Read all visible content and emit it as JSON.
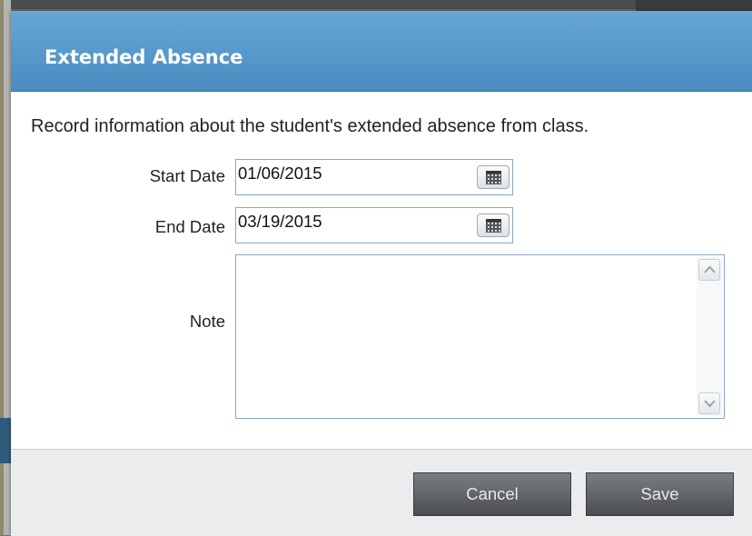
{
  "dialog": {
    "title": "Extended Absence",
    "intro": "Record information about the student's extended absence from class.",
    "fields": {
      "start_date": {
        "label": "Start Date",
        "value": "01/06/2015"
      },
      "end_date": {
        "label": "End Date",
        "value": "03/19/2015"
      },
      "note": {
        "label": "Note",
        "value": ""
      }
    },
    "buttons": {
      "cancel": "Cancel",
      "save": "Save"
    }
  },
  "icons": {
    "calendar": "calendar-icon",
    "scroll_up": "chevron-up-icon",
    "scroll_down": "chevron-down-icon"
  },
  "colors": {
    "titlebar": "#4b8cc0",
    "button": "#5e6063"
  }
}
